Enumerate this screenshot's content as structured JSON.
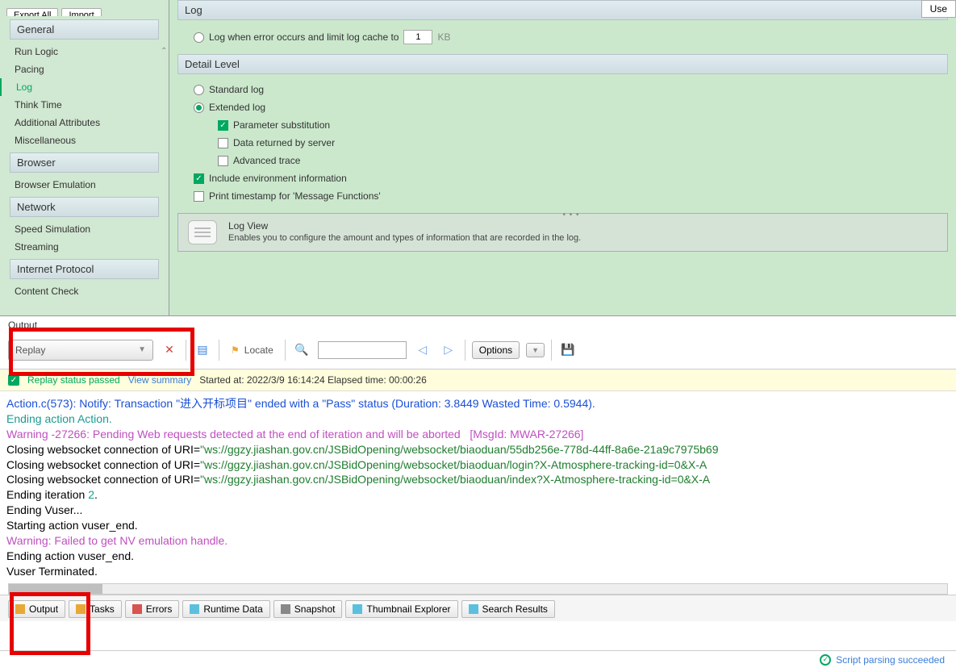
{
  "topButtons": {
    "export": "Export All",
    "import": "Import"
  },
  "sidebar": {
    "general": {
      "title": "General",
      "items": [
        "Run Logic",
        "Pacing",
        "Log",
        "Think Time",
        "Additional Attributes",
        "Miscellaneous"
      ],
      "activeIndex": 2
    },
    "browser": {
      "title": "Browser",
      "items": [
        "Browser Emulation"
      ]
    },
    "network": {
      "title": "Network",
      "items": [
        "Speed Simulation",
        "Streaming"
      ]
    },
    "internet": {
      "title": "Internet Protocol",
      "items": [
        "Content Check"
      ]
    }
  },
  "settings": {
    "log_section": "Log",
    "use_btn": "Use",
    "log_when_error": "Log when error occurs and limit log cache to",
    "log_cache_value": "1",
    "kb": "KB",
    "detail_section": "Detail Level",
    "standard_log": "Standard log",
    "extended_log": "Extended log",
    "param_sub": "Parameter substitution",
    "data_returned": "Data returned by server",
    "adv_trace": "Advanced trace",
    "include_env": "Include environment information",
    "print_ts": "Print timestamp for 'Message Functions'",
    "logview_title": "Log View",
    "logview_desc": "Enables you to configure the amount and types of information that are recorded in the log."
  },
  "output": {
    "title": "Output",
    "replay_dd": "Replay",
    "locate": "Locate",
    "options": "Options",
    "status_pass": "Replay status passed",
    "view_summary": "View summary",
    "started": "Started at: 2022/3/9 16:14:24 Elapsed time: 00:00:26"
  },
  "console_lines": [
    {
      "cls": "blue",
      "text": "Action.c(573): Notify: Transaction \"进入开标项目\" ended with a \"Pass\" status (Duration: 3.8449 Wasted Time: 0.5944)."
    },
    {
      "cls": "teal",
      "text": "Ending action Action."
    },
    {
      "cls": "magenta",
      "text": "Warning -27266: Pending Web requests detected at the end of iteration and will be aborted   [MsgId: MWAR-27266]"
    },
    {
      "cls": "mix1",
      "pre": "Closing websocket connection of URI=",
      "uri": "\"ws://ggzy.jiashan.gov.cn/JSBidOpening/websocket/biaoduan/55db256e-778d-44ff-8a6e-21a9c7975b69"
    },
    {
      "cls": "mix1",
      "pre": "Closing websocket connection of URI=",
      "uri": "\"ws://ggzy.jiashan.gov.cn/JSBidOpening/websocket/biaoduan/login?X-Atmosphere-tracking-id=0&X-A"
    },
    {
      "cls": "mix1",
      "pre": "Closing websocket connection of URI=",
      "uri": "\"ws://ggzy.jiashan.gov.cn/JSBidOpening/websocket/biaoduan/index?X-Atmosphere-tracking-id=0&X-A"
    },
    {
      "cls": "mix2",
      "pre": "Ending iteration ",
      "num": "2",
      "post": "."
    },
    {
      "cls": "",
      "text": "Ending Vuser..."
    },
    {
      "cls": "",
      "text": "Starting action vuser_end."
    },
    {
      "cls": "magenta",
      "text": "Warning: Failed to get NV emulation handle."
    },
    {
      "cls": "",
      "text": "Ending action vuser_end."
    },
    {
      "cls": "",
      "text": "Vuser Terminated."
    }
  ],
  "tabs": [
    "Output",
    "Tasks",
    "Errors",
    "Runtime Data",
    "Snapshot",
    "Thumbnail Explorer",
    "Search Results"
  ],
  "tab_icons": [
    "#e8a838",
    "#e8a838",
    "#d9534f",
    "#5bc0de",
    "#888",
    "#5bc0de",
    "#5bc0de"
  ],
  "footer": "Script parsing succeeded"
}
